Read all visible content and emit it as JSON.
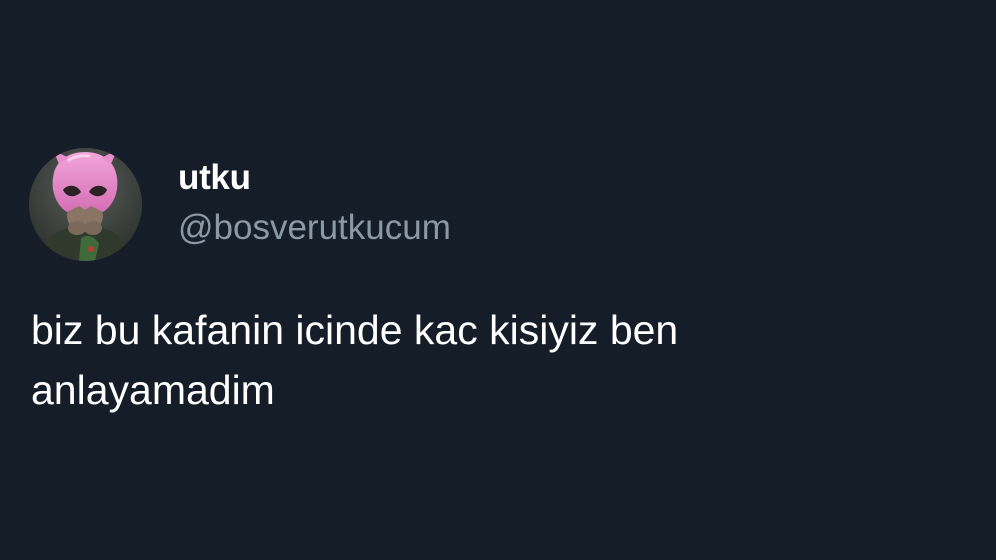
{
  "tweet": {
    "display_name": "utku",
    "handle": "@bosverutkucum",
    "text": "biz bu kafanin icinde kac kisiyiz ben\nanlayamadim",
    "avatar_icon": "profile-photo-pink-mask"
  },
  "colors": {
    "background": "#151d28",
    "name_text": "#ffffff",
    "handle_text": "#8b98a5",
    "body_text": "#ffffff",
    "avatar_mask": "#e889c9"
  }
}
